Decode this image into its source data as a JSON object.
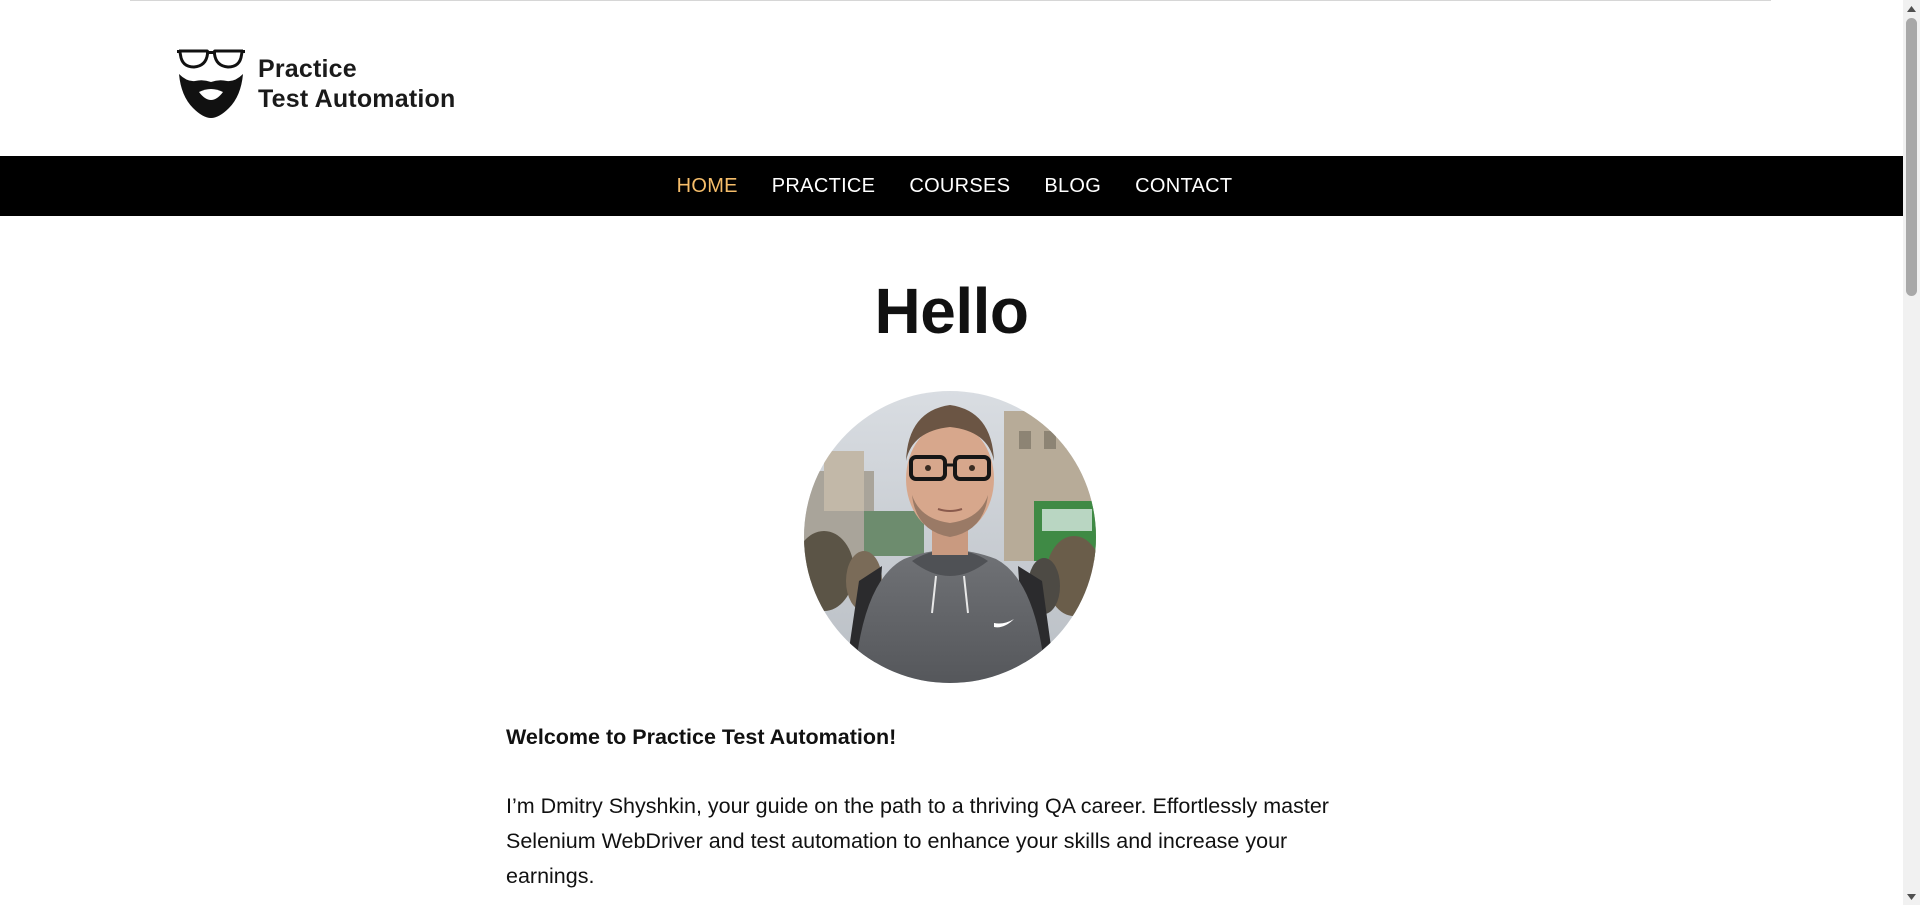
{
  "header": {
    "logo": {
      "line1": "Practice",
      "line2": "Test Automation",
      "icon": "glasses-beard-logo-icon"
    }
  },
  "nav": {
    "items": [
      {
        "label": "HOME",
        "active": true
      },
      {
        "label": "PRACTICE",
        "active": false
      },
      {
        "label": "COURSES",
        "active": false
      },
      {
        "label": "BLOG",
        "active": false
      },
      {
        "label": "CONTACT",
        "active": false
      }
    ],
    "active_color": "#f5bd6a",
    "background": "#000000"
  },
  "main": {
    "title": "Hello",
    "avatar_icon": "profile-photo",
    "welcome": "Welcome to Practice Test Automation!",
    "intro": "I’m Dmitry Shyshkin, your guide on the path to a thriving QA career. Effortlessly master Selenium WebDriver and test automation to enhance your skills and increase your earnings."
  },
  "scrollbar": {
    "up_icon": "scroll-up-arrow-icon",
    "down_icon": "scroll-down-arrow-icon"
  }
}
